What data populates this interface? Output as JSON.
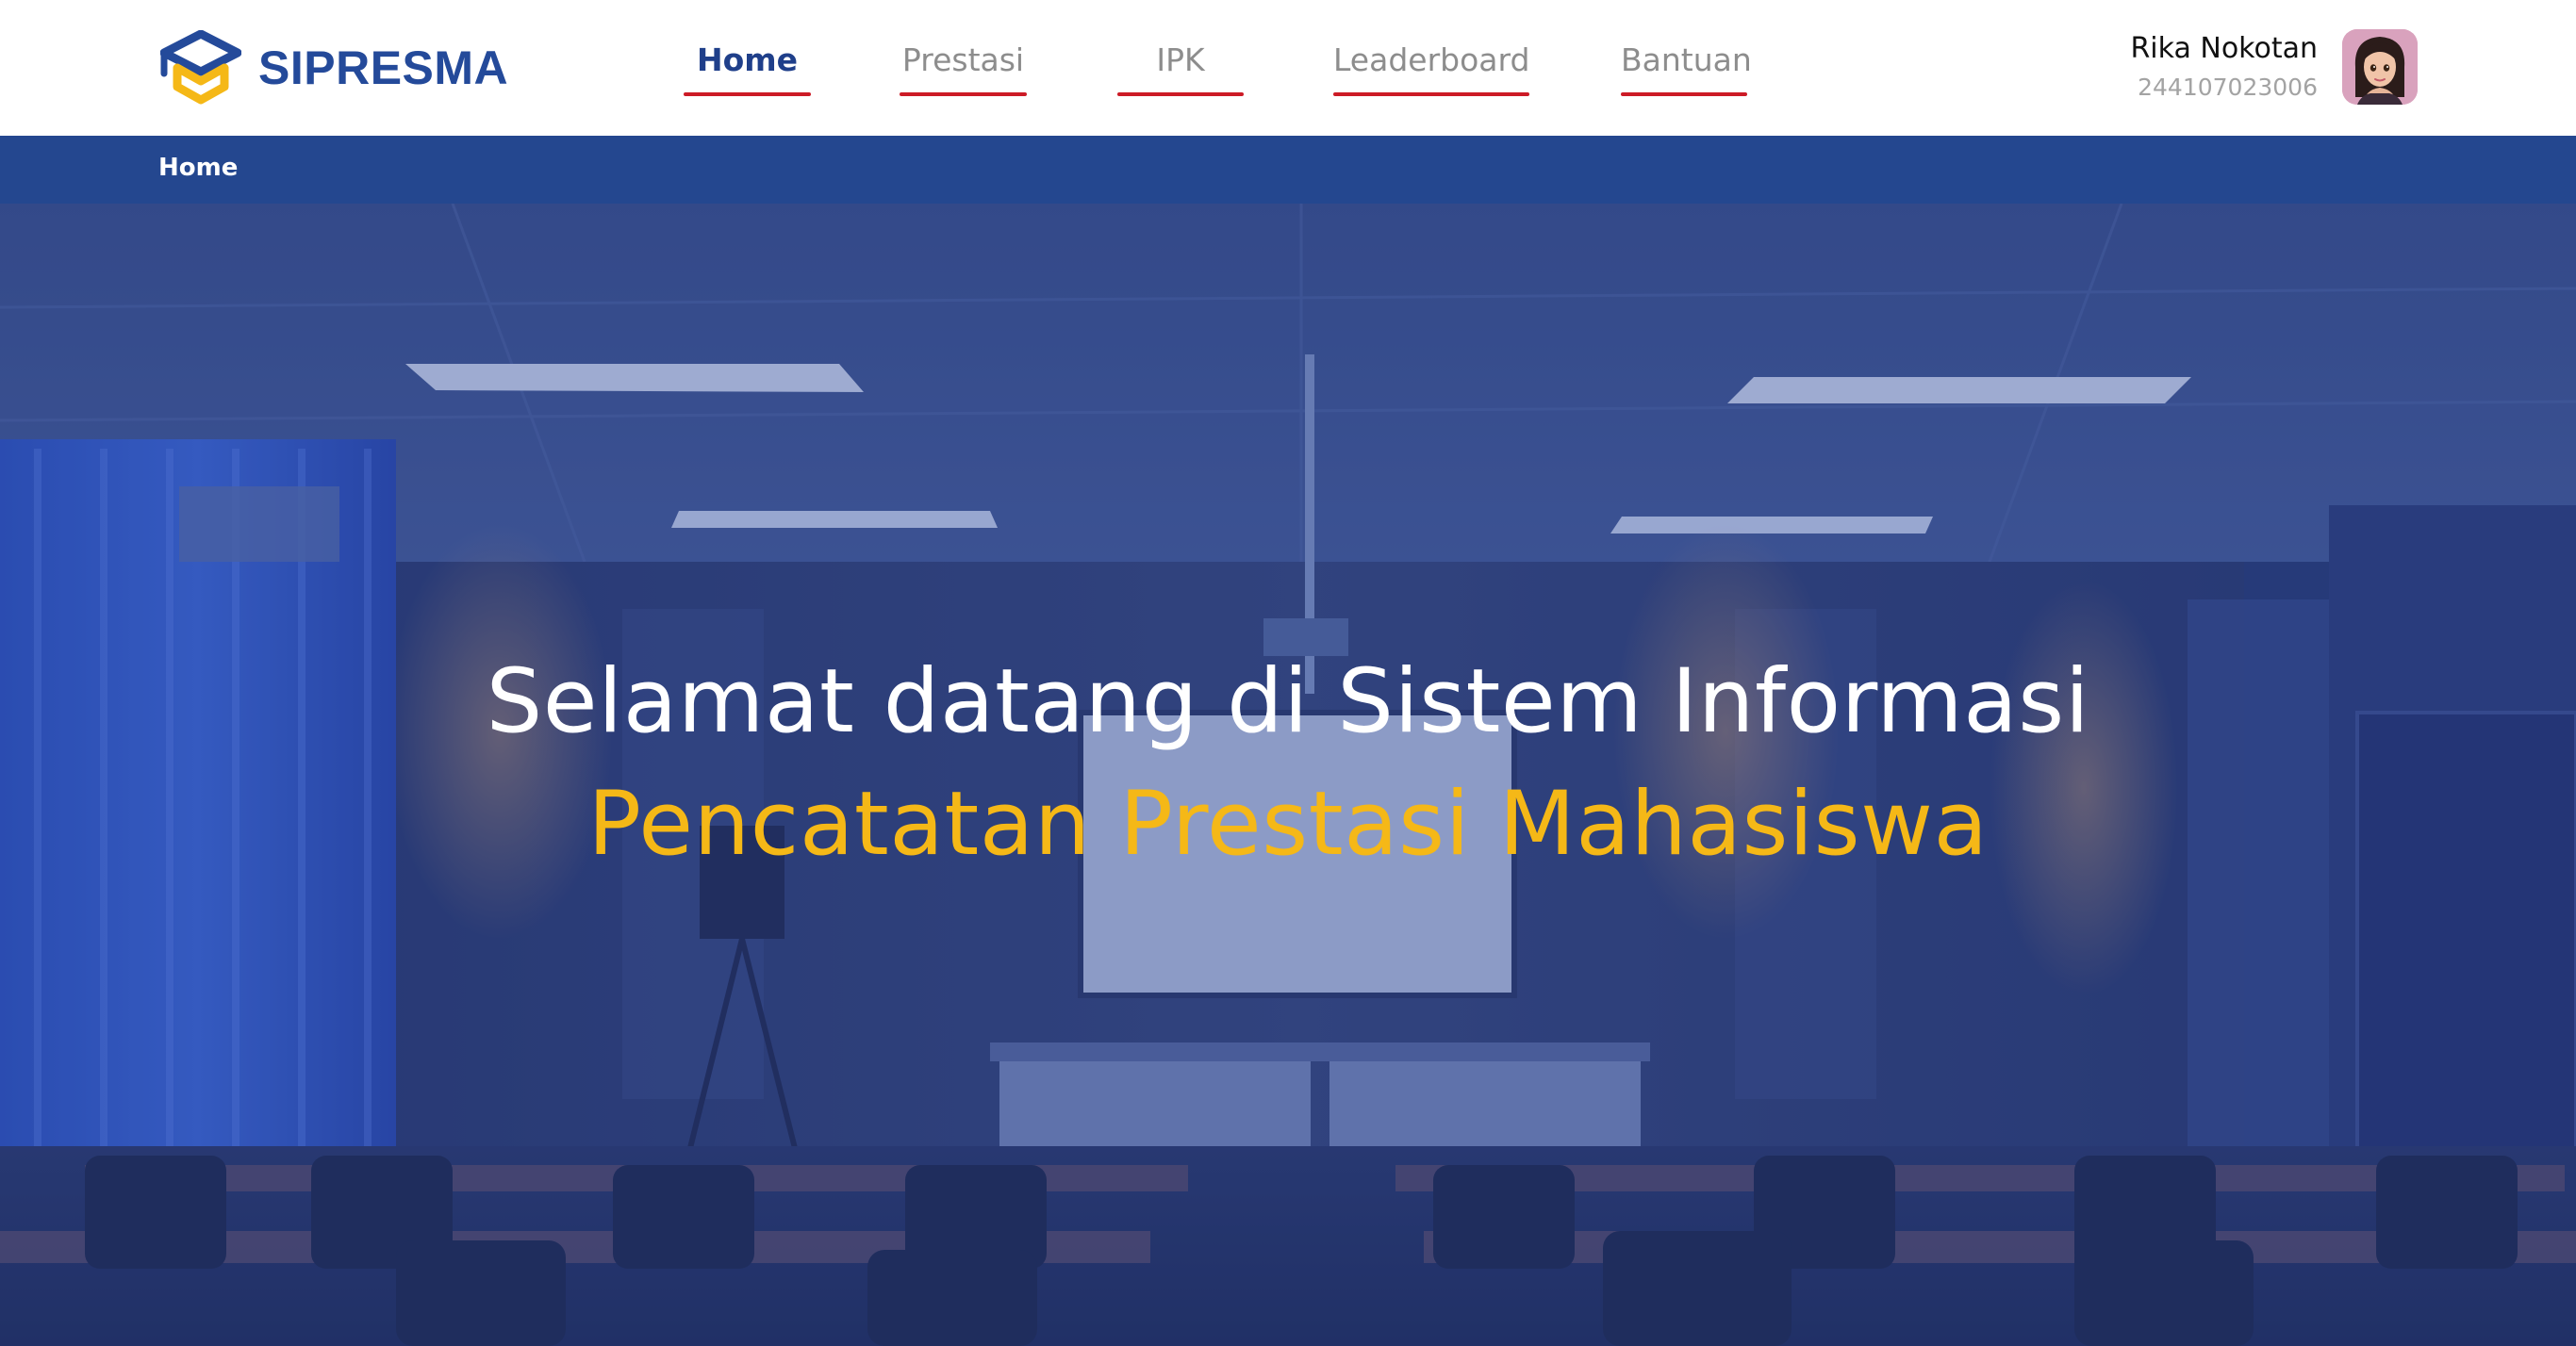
{
  "brand": {
    "name": "SIPRESMA",
    "logo_icon": "graduation-cap-icon",
    "colors": {
      "blue": "#244a9a",
      "yellow": "#f5b817"
    }
  },
  "nav": {
    "items": [
      {
        "label": "Home",
        "active": true
      },
      {
        "label": "Prestasi",
        "active": false
      },
      {
        "label": "IPK",
        "active": false
      },
      {
        "label": "Leaderboard",
        "active": false
      },
      {
        "label": "Bantuan",
        "active": false
      }
    ],
    "underline_color": "#cc1b26"
  },
  "user": {
    "name": "Rika Nokotan",
    "id": "244107023006",
    "avatar_icon": "user-avatar"
  },
  "breadcrumb": {
    "items": [
      "Home"
    ],
    "background": "#24478f"
  },
  "hero": {
    "title_line1": "Selamat datang di Sistem Informasi",
    "title_line2": "Pencatatan Prestasi Mahasiswa",
    "line1_color": "#ffffff",
    "line2_color": "#f5b817",
    "background": "classroom-photo-blue-tint"
  }
}
